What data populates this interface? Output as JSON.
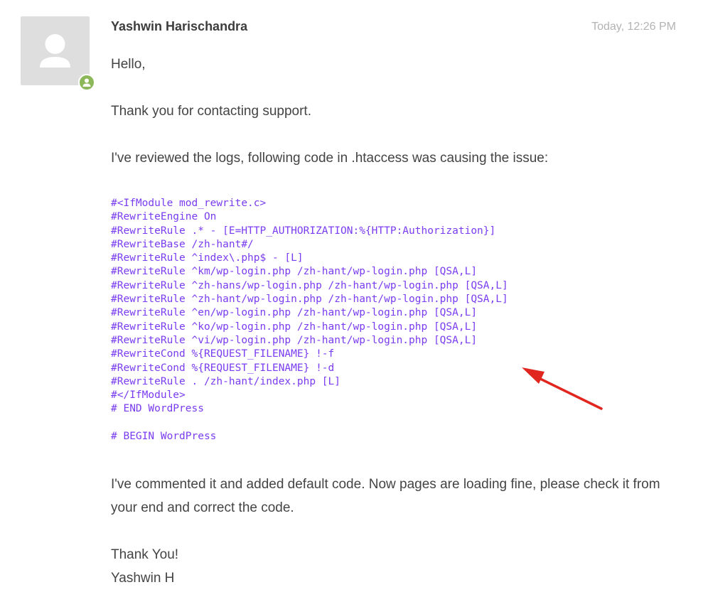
{
  "message": {
    "author": "Yashwin Harischandra",
    "timestamp": "Today, 12:26 PM",
    "greeting": "Hello,",
    "thanks": "Thank you for contacting support.",
    "review": "I've reviewed the logs, following code in .htaccess was causing the issue:",
    "code_lines": [
      "#<IfModule mod_rewrite.c>",
      "#RewriteEngine On",
      "#RewriteRule .* - [E=HTTP_AUTHORIZATION:%{HTTP:Authorization}]",
      "#RewriteBase /zh-hant#/",
      "#RewriteRule ^index\\.php$ - [L]",
      "#RewriteRule ^km/wp-login.php /zh-hant/wp-login.php [QSA,L]",
      "#RewriteRule ^zh-hans/wp-login.php /zh-hant/wp-login.php [QSA,L]",
      "#RewriteRule ^zh-hant/wp-login.php /zh-hant/wp-login.php [QSA,L]",
      "#RewriteRule ^en/wp-login.php /zh-hant/wp-login.php [QSA,L]",
      "#RewriteRule ^ko/wp-login.php /zh-hant/wp-login.php [QSA,L]",
      "#RewriteRule ^vi/wp-login.php /zh-hant/wp-login.php [QSA,L]",
      "#RewriteCond %{REQUEST_FILENAME} !-f",
      "#RewriteCond %{REQUEST_FILENAME} !-d",
      "#RewriteRule . /zh-hant/index.php [L]",
      "#</IfModule>",
      "# END WordPress",
      "",
      "# BEGIN WordPress"
    ],
    "result": "I've commented it and added default code. Now pages are loading fine, please check it from your end and correct the code.",
    "signoff_line1": "Thank You!",
    "signoff_line2": "Yashwin H"
  },
  "icons": {
    "avatar": "default-user-avatar-icon",
    "status": "user-status-icon",
    "annotation": "red-arrow-icon"
  },
  "colors": {
    "code": "#7a3cf0",
    "status": "#8cb85a",
    "arrow": "#e0261f",
    "timestamp": "#b3b3b3"
  }
}
